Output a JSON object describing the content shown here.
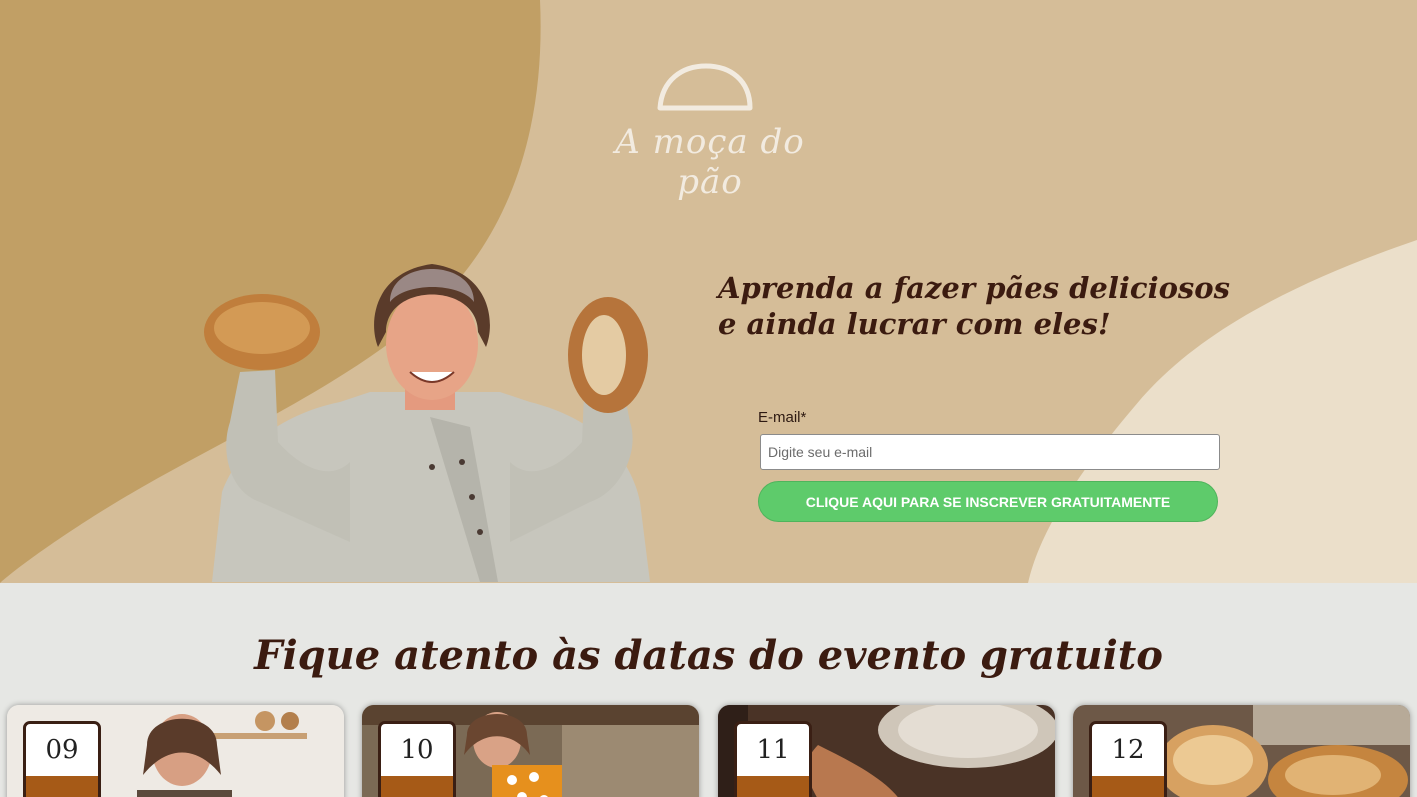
{
  "brand": {
    "name": "A moça do pão",
    "logo_icon": "bread-dome-icon"
  },
  "hero": {
    "headline": "Aprenda a fazer pães deliciosos e ainda lucrar com eles!",
    "form": {
      "email_label": "E-mail*",
      "email_placeholder": "Digite seu e-mail",
      "email_value": "",
      "submit_label": "CLIQUE AQUI PARA SE INSCREVER GRATUITAMENTE"
    }
  },
  "events": {
    "title": "Fique atento às datas do evento gratuito",
    "dates": [
      {
        "day": "09"
      },
      {
        "day": "10"
      },
      {
        "day": "11"
      },
      {
        "day": "12"
      }
    ]
  },
  "colors": {
    "hero_bg": "#d5bd98",
    "hero_dark_shape": "#c19f65",
    "hero_light_shape": "#ebdfca",
    "section_bg": "#e6e7e4",
    "text_dark": "#3b1b10",
    "button_green": "#5ecb6b",
    "date_band": "#a65a17"
  }
}
